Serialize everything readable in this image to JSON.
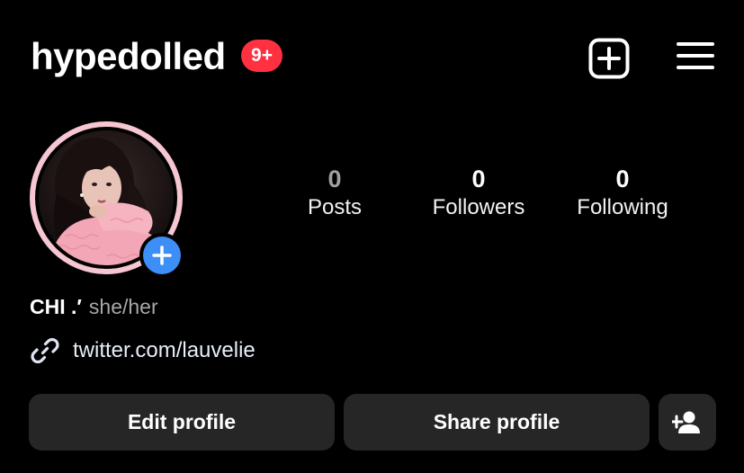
{
  "header": {
    "username": "hypedolled",
    "notification_badge": "9+",
    "new_post_icon": "plus-square-icon",
    "menu_icon": "hamburger-menu-icon"
  },
  "profile": {
    "avatar_icon": "profile-photo",
    "add_story_icon": "plus-icon",
    "display_name": "CHI .′",
    "pronouns": "she/her",
    "link_icon": "link-icon",
    "link": "twitter.com/lauvelie"
  },
  "stats": {
    "posts": {
      "value": "0",
      "label": "Posts"
    },
    "followers": {
      "value": "0",
      "label": "Followers"
    },
    "following": {
      "value": "0",
      "label": "Following"
    }
  },
  "actions": {
    "edit_profile": "Edit profile",
    "share_profile": "Share profile",
    "discover_people_icon": "add-person-icon"
  },
  "colors": {
    "background": "#000000",
    "badge": "#ff3040",
    "add_story": "#3e8ef7",
    "button_bg": "#262626",
    "avatar_ring": "#f6c6d2"
  }
}
